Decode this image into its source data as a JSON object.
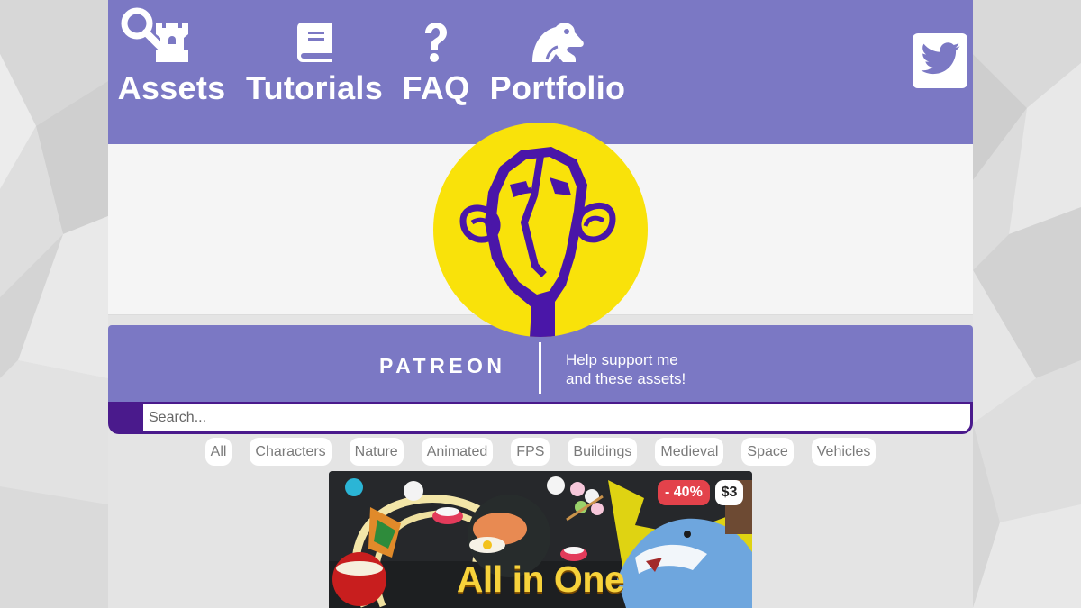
{
  "nav": {
    "items": [
      {
        "label": "Assets",
        "icon": "castle-rook-icon"
      },
      {
        "label": "Tutorials",
        "icon": "book-icon"
      },
      {
        "label": "FAQ",
        "icon": "question-icon"
      },
      {
        "label": "Portfolio",
        "icon": "frog-icon"
      }
    ],
    "twitter_icon": "twitter-bird-icon"
  },
  "banner": {
    "logo_icon": "robot-head-logo"
  },
  "patreon": {
    "wordmark": "PATREON",
    "tagline_line1": "Help support me",
    "tagline_line2": "and these assets!"
  },
  "search": {
    "placeholder": "Search...",
    "icon": "search-icon"
  },
  "filters": [
    "All",
    "Characters",
    "Nature",
    "Animated",
    "FPS",
    "Buildings",
    "Medieval",
    "Space",
    "Vehicles"
  ],
  "card": {
    "title": "All in One",
    "discount": "- 40%",
    "price": "$3"
  },
  "colors": {
    "nav_bg": "#7b78c4",
    "search_accent": "#4a1a8c",
    "logo_yellow": "#f9e20a",
    "logo_purple": "#4a16a8",
    "discount_red": "#e3424b",
    "card_title_yellow": "#f7d23b"
  }
}
